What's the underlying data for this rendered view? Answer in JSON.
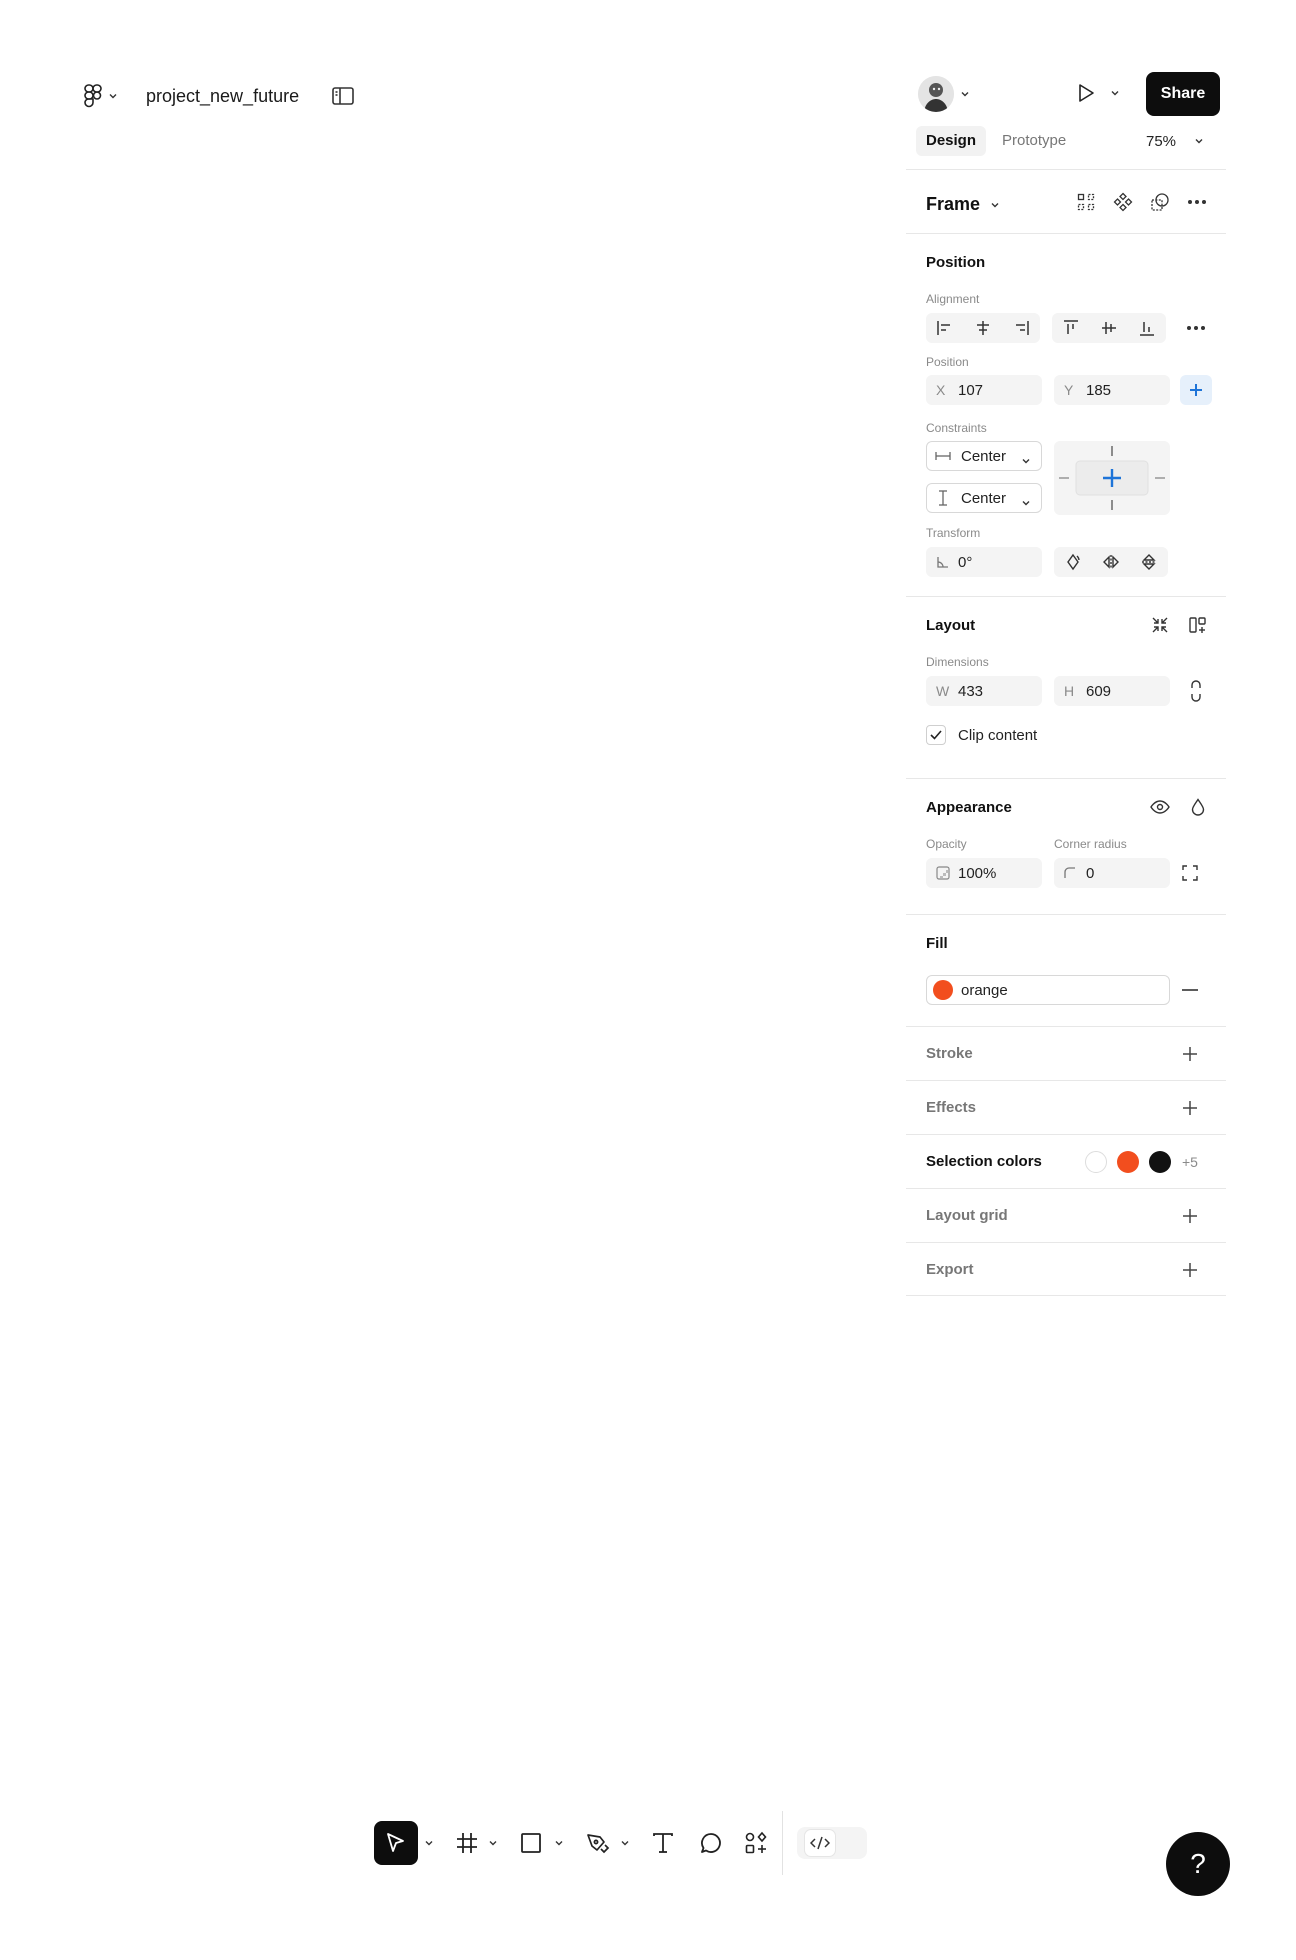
{
  "header": {
    "file_name": "project_new_future",
    "logo_icon": "figma-logo-icon",
    "sidebar_icon": "sidebar-toggle-icon"
  },
  "topbar": {
    "share_label": "Share",
    "present_icon": "play-icon"
  },
  "tabs": [
    {
      "label": "Design",
      "active": true
    },
    {
      "label": "Prototype",
      "active": false
    }
  ],
  "zoom": "75%",
  "frame": {
    "title": "Frame",
    "icons": [
      "grid-icon",
      "component-icon",
      "mask-icon",
      "more-icon"
    ]
  },
  "position_section": {
    "title": "Position",
    "alignment_label": "Alignment",
    "position_label": "Position",
    "x_prefix": "X",
    "x_value": "107",
    "y_prefix": "Y",
    "y_value": "185",
    "constraints_label": "Constraints",
    "constraint_h": "Center",
    "constraint_v": "Center",
    "transform_label": "Transform",
    "rotation": "0°"
  },
  "layout_section": {
    "title": "Layout",
    "dimensions_label": "Dimensions",
    "w_prefix": "W",
    "w_value": "433",
    "h_prefix": "H",
    "h_value": "609",
    "clip_label": "Clip content",
    "clip_checked": true
  },
  "appearance_section": {
    "title": "Appearance",
    "opacity_label": "Opacity",
    "opacity_value": "100%",
    "radius_label": "Corner radius",
    "radius_value": "0"
  },
  "fill_section": {
    "title": "Fill",
    "fill_name": "orange",
    "fill_color": "#F24E1E"
  },
  "stroke_section": {
    "title": "Stroke"
  },
  "effects_section": {
    "title": "Effects"
  },
  "selection_colors": {
    "title": "Selection colors",
    "colors": [
      "#FFFFFF",
      "#F24E1E",
      "#111111"
    ],
    "more": "+5"
  },
  "layout_grid_section": {
    "title": "Layout grid"
  },
  "export_section": {
    "title": "Export"
  },
  "toolbar": {
    "tools": [
      "move-tool",
      "frame-tool",
      "rectangle-tool",
      "pen-tool",
      "text-tool",
      "comment-tool",
      "actions-tool"
    ],
    "active_tool": "move-tool"
  },
  "help_label": "?"
}
